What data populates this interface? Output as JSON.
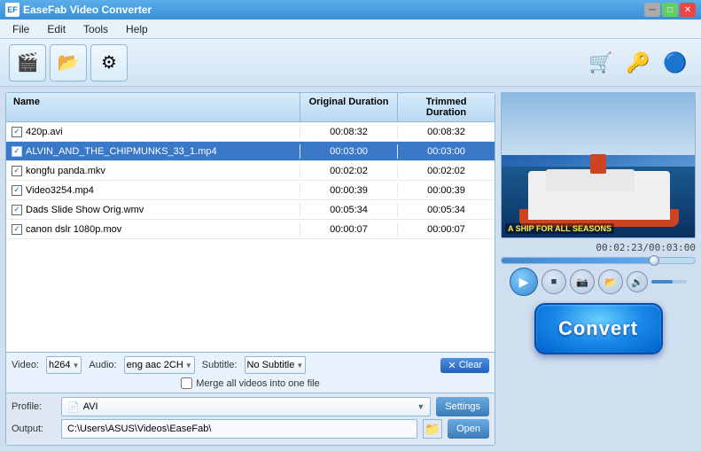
{
  "titlebar": {
    "title": "EaseFab Video Converter",
    "icon": "EF"
  },
  "menubar": {
    "items": [
      "File",
      "Edit",
      "Tools",
      "Help"
    ]
  },
  "toolbar": {
    "buttons": [
      {
        "name": "add-video",
        "icon": "🎬"
      },
      {
        "name": "add-folder",
        "icon": "📁"
      },
      {
        "name": "settings",
        "icon": "⚙"
      }
    ],
    "right_buttons": [
      {
        "name": "shop",
        "icon": "🛒"
      },
      {
        "name": "key",
        "icon": "🔑"
      },
      {
        "name": "help",
        "icon": "🔵"
      }
    ]
  },
  "file_list": {
    "headers": {
      "name": "Name",
      "original_duration": "Original Duration",
      "trimmed_duration": "Trimmed Duration"
    },
    "rows": [
      {
        "id": 1,
        "checked": true,
        "name": "420p.avi",
        "original": "00:08:32",
        "trimmed": "00:08:32",
        "selected": false
      },
      {
        "id": 2,
        "checked": true,
        "name": "ALVIN_AND_THE_CHIPMUNKS_33_1.mp4",
        "original": "00:03:00",
        "trimmed": "00:03:00",
        "selected": true
      },
      {
        "id": 3,
        "checked": true,
        "name": "kongfu panda.mkv",
        "original": "00:02:02",
        "trimmed": "00:02:02",
        "selected": false
      },
      {
        "id": 4,
        "checked": true,
        "name": "Video3254.mp4",
        "original": "00:00:39",
        "trimmed": "00:00:39",
        "selected": false
      },
      {
        "id": 5,
        "checked": true,
        "name": "Dads Slide Show Orig.wmv",
        "original": "00:05:34",
        "trimmed": "00:05:34",
        "selected": false
      },
      {
        "id": 6,
        "checked": true,
        "name": "canon dslr 1080p.mov",
        "original": "00:00:07",
        "trimmed": "00:00:07",
        "selected": false
      }
    ]
  },
  "controls": {
    "video_label": "Video:",
    "video_value": "h264",
    "audio_label": "Audio:",
    "audio_value": "eng aac 2CH",
    "subtitle_label": "Subtitle:",
    "subtitle_value": "No Subtitle",
    "clear_label": "Clear",
    "merge_label": "Merge all videos into one file"
  },
  "profile": {
    "label": "Profile:",
    "value": "AVI",
    "settings_label": "Settings"
  },
  "output": {
    "label": "Output:",
    "path": "C:\\Users\\ASUS\\Videos\\EaseFab\\",
    "open_label": "Open"
  },
  "preview": {
    "time_display": "00:02:23/00:03:00",
    "progress_percent": 79,
    "overlay_text": "A SHIP FOR ALL SEASONS"
  },
  "convert": {
    "label": "Convert"
  }
}
